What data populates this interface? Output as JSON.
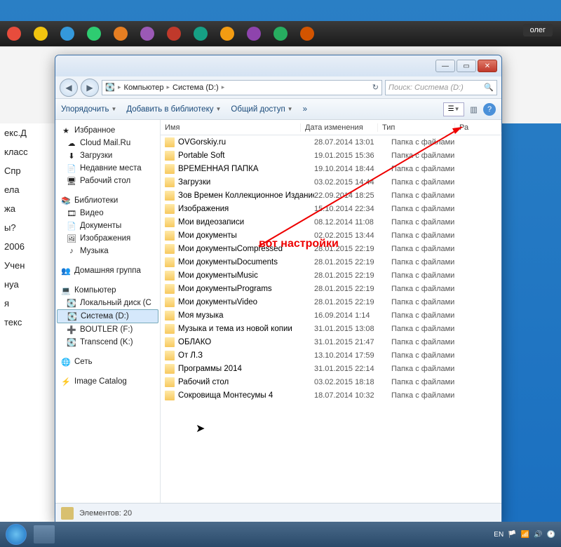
{
  "taskbar_user": "олег",
  "browser_bits": [
    "екс.Д",
    "класс",
    "Спр",
    "ела",
    "жа",
    "ы?",
    "2006",
    "Учен",
    "нуа",
    "я",
    "текс"
  ],
  "window": {
    "min": "—",
    "max": "▭",
    "close": "✕",
    "nav_back": "◀",
    "nav_fwd": "▶",
    "breadcrumb": [
      "Компьютер",
      "Система (D:)"
    ],
    "search_placeholder": "Поиск: Система (D:)",
    "toolbar": {
      "organize": "Упорядочить",
      "add_library": "Добавить в библиотеку",
      "share": "Общий доступ",
      "new_folder_icon": "»"
    },
    "columns": {
      "name": "Имя",
      "date": "Дата изменения",
      "type": "Тип",
      "size": "Ра"
    },
    "statusbar": "Элементов: 20"
  },
  "nav": {
    "favorites": {
      "label": "Избранное",
      "items": [
        {
          "icon": "☁",
          "label": "Cloud Mail.Ru"
        },
        {
          "icon": "⬇",
          "label": "Загрузки"
        },
        {
          "icon": "📄",
          "label": "Недавние места"
        },
        {
          "icon": "🖥",
          "label": "Рабочий стол"
        }
      ]
    },
    "libraries": {
      "label": "Библиотеки",
      "items": [
        {
          "icon": "🎞",
          "label": "Видео"
        },
        {
          "icon": "📄",
          "label": "Документы"
        },
        {
          "icon": "🖼",
          "label": "Изображения"
        },
        {
          "icon": "♪",
          "label": "Музыка"
        }
      ]
    },
    "homegroup": {
      "label": "Домашняя группа"
    },
    "computer": {
      "label": "Компьютер",
      "items": [
        {
          "icon": "💽",
          "label": "Локальный диск (C"
        },
        {
          "icon": "💽",
          "label": "Система (D:)",
          "selected": true
        },
        {
          "icon": "➕",
          "label": "BOUTLER (F:)"
        },
        {
          "icon": "💽",
          "label": "Transcend (K:)"
        }
      ]
    },
    "network": {
      "label": "Сеть"
    },
    "catalog": {
      "label": "Image Catalog"
    }
  },
  "files": [
    {
      "name": "OVGorskiy.ru",
      "date": "28.07.2014 13:01",
      "type": "Папка с файлами"
    },
    {
      "name": "Portable Soft",
      "date": "19.01.2015 15:36",
      "type": "Папка с файлами"
    },
    {
      "name": "ВРЕМЕННАЯ ПАПКА",
      "date": "19.10.2014 18:44",
      "type": "Папка с файлами"
    },
    {
      "name": "Загрузки",
      "date": "03.02.2015 14:44",
      "type": "Папка с файлами"
    },
    {
      "name": "Зов Времен Коллекционное Издание",
      "date": "22.09.2014 18:25",
      "type": "Папка с файлами"
    },
    {
      "name": "Изображения",
      "date": "15.10.2014 22:34",
      "type": "Папка с файлами"
    },
    {
      "name": "Мои видеозаписи",
      "date": "08.12.2014 11:08",
      "type": "Папка с файлами"
    },
    {
      "name": "Мои документы",
      "date": "02.02.2015 13:44",
      "type": "Папка с файлами"
    },
    {
      "name": "Мои документыCompressed",
      "date": "28.01.2015 22:19",
      "type": "Папка с файлами"
    },
    {
      "name": "Мои документыDocuments",
      "date": "28.01.2015 22:19",
      "type": "Папка с файлами"
    },
    {
      "name": "Мои документыMusic",
      "date": "28.01.2015 22:19",
      "type": "Папка с файлами"
    },
    {
      "name": "Мои документыPrograms",
      "date": "28.01.2015 22:19",
      "type": "Папка с файлами"
    },
    {
      "name": "Мои документыVideo",
      "date": "28.01.2015 22:19",
      "type": "Папка с файлами"
    },
    {
      "name": "Моя музыка",
      "date": "16.09.2014 1:14",
      "type": "Папка с файлами"
    },
    {
      "name": "Музыка и тема из новой копии",
      "date": "31.01.2015 13:08",
      "type": "Папка с файлами"
    },
    {
      "name": "ОБЛАКО",
      "date": "31.01.2015 21:47",
      "type": "Папка с файлами"
    },
    {
      "name": "От Л.З",
      "date": "13.10.2014 17:59",
      "type": "Папка с файлами"
    },
    {
      "name": "Программы 2014",
      "date": "31.01.2015 22:14",
      "type": "Папка с файлами"
    },
    {
      "name": "Рабочий стол",
      "date": "03.02.2015 18:18",
      "type": "Папка с файлами"
    },
    {
      "name": "Сокровища Монтесумы 4",
      "date": "18.07.2014 10:32",
      "type": "Папка с файлами"
    }
  ],
  "annotation_text": "вот настройки",
  "tray": {
    "lang": "EN"
  },
  "tb_colors": [
    "#e74c3c",
    "#f1c40f",
    "#3498db",
    "#2ecc71",
    "#e67e22",
    "#9b59b6",
    "#c0392b",
    "#16a085",
    "#f39c12",
    "#8e44ad",
    "#27ae60",
    "#d35400"
  ]
}
